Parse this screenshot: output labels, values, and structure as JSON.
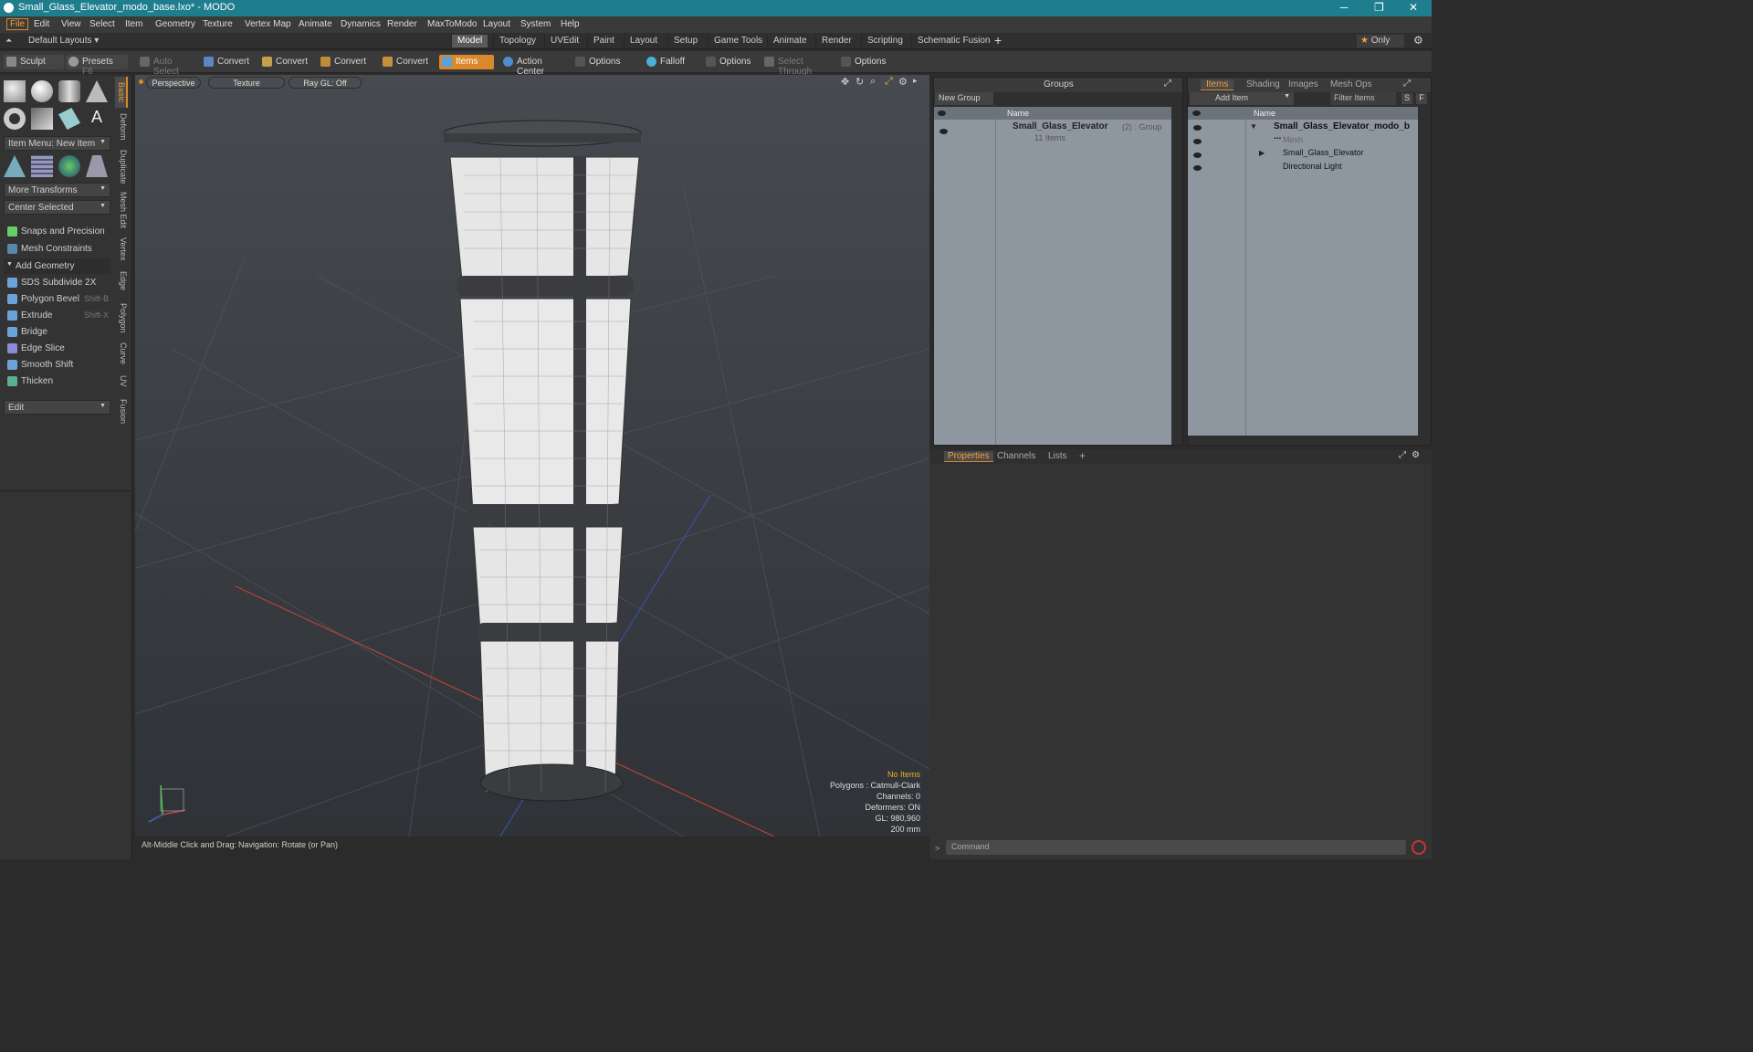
{
  "window": {
    "title": "Small_Glass_Elevator_modo_base.lxo* - MODO",
    "controls": [
      "─",
      "❐",
      "✕"
    ]
  },
  "menu": [
    "File",
    "Edit",
    "View",
    "Select",
    "Item",
    "Geometry",
    "Texture",
    "Vertex Map",
    "Animate",
    "Dynamics",
    "Render",
    "MaxToModo",
    "Layout",
    "System",
    "Help"
  ],
  "layout": {
    "preset": "Default Layouts",
    "tabs": [
      "Model",
      "Topology",
      "UVEdit",
      "Paint",
      "Layout",
      "Setup",
      "Game Tools",
      "Animate",
      "Render",
      "Scripting",
      "Schematic Fusion"
    ],
    "selected_tab": "Model",
    "only": "Only"
  },
  "toolbar": {
    "sculpt": "Sculpt",
    "presets": "Presets",
    "presets_key": "F6",
    "auto_select": "Auto Select",
    "convert": "Convert",
    "items": "Items",
    "action_center": "Action Center",
    "options": "Options",
    "falloff": "Falloff",
    "select_through": "Select Through"
  },
  "left": {
    "item_menu": "Item Menu: New Item",
    "more_transforms": "More Transforms",
    "center_selected": "Center Selected",
    "snaps": "Snaps and Precision",
    "mesh_constraints": "Mesh Constraints",
    "add_geometry": "Add Geometry",
    "tools": [
      {
        "label": "SDS Subdivide 2X",
        "key": ""
      },
      {
        "label": "Polygon Bevel",
        "key": "Shift-B"
      },
      {
        "label": "Extrude",
        "key": "Shift-X"
      },
      {
        "label": "Bridge",
        "key": ""
      },
      {
        "label": "Edge Slice",
        "key": ""
      },
      {
        "label": "Smooth Shift",
        "key": ""
      },
      {
        "label": "Thicken",
        "key": ""
      }
    ],
    "edit": "Edit",
    "vtabs": [
      "Basic",
      "Deform",
      "Duplicate",
      "Mesh Edit",
      "Vertex",
      "Edge",
      "Polygon",
      "Curve",
      "UV",
      "Fusion"
    ]
  },
  "viewport": {
    "perspective": "Perspective",
    "texture": "Texture",
    "raygl": "Ray GL: Off",
    "info": [
      "No Items",
      "Polygons : Catmull-Clark",
      "Channels: 0",
      "Deformers: ON",
      "GL: 980,960",
      "200 mm"
    ]
  },
  "status": {
    "hint": "Alt-Middle Click and Drag:",
    "nav": "Navigation: Rotate (or Pan)"
  },
  "groups": {
    "title": "Groups",
    "new_group": "New Group",
    "name_col": "Name",
    "group_name": "Small_Glass_Elevator",
    "group_meta": "(2) : Group",
    "group_count": "11 Items"
  },
  "items": {
    "tabs": [
      "Items",
      "Shading",
      "Images",
      "Mesh Ops"
    ],
    "add_item": "Add Item",
    "filter": "Filter Items",
    "s": "S",
    "f": "F",
    "name_col": "Name",
    "rows": [
      "Small_Glass_Elevator_modo_b ...",
      "Mesh",
      "Small_Glass_Elevator",
      "Directional Light"
    ]
  },
  "props": {
    "tabs": [
      "Properties",
      "Channels",
      "Lists"
    ],
    "command": "Command"
  },
  "colors": {
    "accent": "#d9892a",
    "title": "#1f7e8e"
  }
}
